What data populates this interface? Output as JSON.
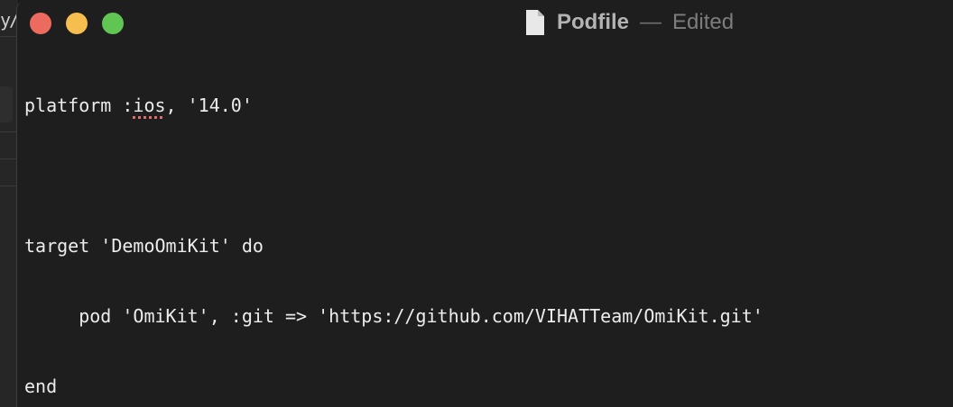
{
  "background_window": {
    "fragment": "y/"
  },
  "window": {
    "title": "Podfile",
    "separator": "—",
    "status": "Edited",
    "icon": "document-icon",
    "traffic_lights": {
      "close": "#ed6a5e",
      "minimize": "#f5be4f",
      "zoom": "#61c554"
    }
  },
  "editor": {
    "lines": [
      {
        "pre": "platform :",
        "flagged": "ios",
        "post": ", '14.0'"
      },
      {
        "text": ""
      },
      {
        "text": "target 'DemoOmiKit' do"
      },
      {
        "text": "     pod 'OmiKit', :git => 'https://github.com/VIHATTeam/OmiKit.git'"
      },
      {
        "text": "end"
      }
    ]
  }
}
